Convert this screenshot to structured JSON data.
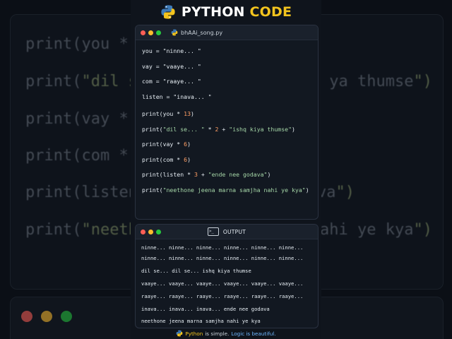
{
  "header": {
    "title_python": "PYTHON",
    "title_code": "CODE"
  },
  "editor": {
    "filename": "bhAAi_song.py",
    "lines": {
      "l1": "you = \"ninne... \"",
      "l2": "vay = \"vaaye... \"",
      "l3": "com = \"raaye... \"",
      "l4": "listen = \"inava... \"",
      "p1_a": "print(you * ",
      "p1_n": "13",
      "p1_b": ")",
      "p2_a": "print(",
      "p2_s1": "\"dil se... \"",
      "p2_b": " * ",
      "p2_n": "2",
      "p2_c": " + ",
      "p2_s2": "\"ishq kiya thumse\"",
      "p2_d": ")",
      "p3_a": "print(vay * ",
      "p3_n": "6",
      "p3_b": ")",
      "p4_a": "print(com * ",
      "p4_n": "6",
      "p4_b": ")",
      "p5_a": "print(listen * ",
      "p5_n": "3",
      "p5_b": " + ",
      "p5_s": "\"ende nee godava\"",
      "p5_c": ")",
      "p6_a": "print(",
      "p6_s": "\"neethone jeena marna samjha nahi ye kya\"",
      "p6_b": ")"
    }
  },
  "output": {
    "label": "OUTPUT",
    "lines": [
      "ninne... ninne... ninne... ninne... ninne... ninne...",
      "ninne... ninne... ninne... ninne... ninne... ninne...",
      "dil se... dil se... ishq kiya thumse",
      "vaaye... vaaye... vaaye... vaaye... vaaye... vaaye...",
      "raaye... raaye... raaye... raaye... raaye... raaye...",
      "inava... inava... inava... ende nee godava",
      "neethone jeena marna samjha nahi ye kya"
    ]
  },
  "footer": {
    "python": "Python",
    "is_simple": "is simple.",
    "logic": "Logic is beautiful."
  },
  "background": {
    "line1": "print(you *",
    "line2a": "print(\"dil s",
    "line2b": "ya thumse\")",
    "line3": "print(vay *",
    "line4": "print(com *",
    "line5a": "print(listen",
    "line5b": "va\")",
    "line6a": "print(\"neetho",
    "line6b": "nahi ye kya\")"
  },
  "colors": {
    "accent_yellow": "#f3c41e",
    "string_green": "#a5d6a7",
    "number_orange": "#ff9e64",
    "logic_blue": "#6fb7ff"
  }
}
